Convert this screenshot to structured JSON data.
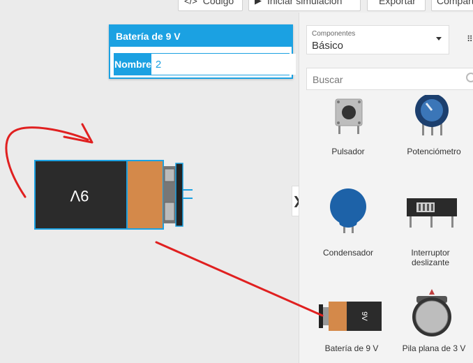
{
  "toolbar": {
    "code_label": "Código",
    "simulate_label": "Iniciar simulación",
    "export_label": "Exportar",
    "share_label": "Compartir"
  },
  "properties": {
    "title": "Batería de 9 V",
    "name_label": "Nombre",
    "name_value": "2"
  },
  "canvas": {
    "battery_label": "9V"
  },
  "sidebar": {
    "components_label": "Componentes",
    "components_value": "Básico",
    "search_placeholder": "Buscar",
    "components": [
      {
        "name": "Pulsador",
        "icon": "pushbutton-icon"
      },
      {
        "name": "Potenciómetro",
        "icon": "potentiometer-icon"
      },
      {
        "name": "Condensador",
        "icon": "capacitor-icon"
      },
      {
        "name": "Interruptor deslizante",
        "icon": "slide-switch-icon"
      },
      {
        "name": "Batería de 9 V",
        "icon": "battery-9v-icon",
        "label": "9V"
      },
      {
        "name": "Pila plana de 3 V",
        "icon": "coin-cell-icon"
      }
    ]
  },
  "colors": {
    "accent": "#1ba1e2",
    "battery_body": "#2b2b2b",
    "battery_band": "#d4894a",
    "annotation": "#e02020"
  }
}
